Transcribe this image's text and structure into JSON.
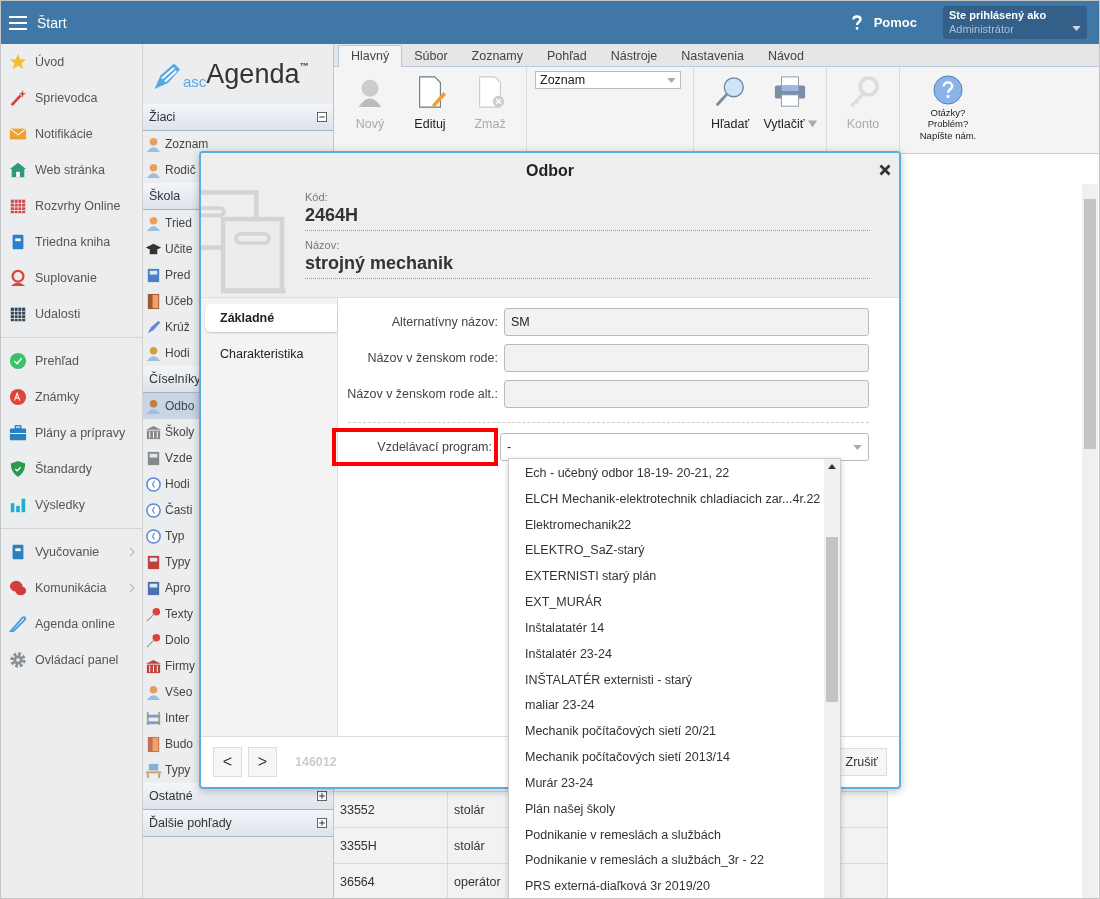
{
  "top_bar": {
    "title": "Štart",
    "help": "Pomoc",
    "user_caption": "Ste prihlásený ako",
    "user_name": "Administrátor"
  },
  "nav": {
    "groups": [
      [
        {
          "label": "Úvod",
          "submenu": false
        },
        {
          "label": "Sprievodca",
          "submenu": false
        },
        {
          "label": "Notifikácie",
          "submenu": false
        },
        {
          "label": "Web stránka",
          "submenu": false
        },
        {
          "label": "Rozvrhy Online",
          "submenu": false
        },
        {
          "label": "Triedna kniha",
          "submenu": false
        },
        {
          "label": "Suplovanie",
          "submenu": false
        },
        {
          "label": "Udalosti",
          "submenu": false
        }
      ],
      [
        {
          "label": "Prehľad",
          "submenu": false
        },
        {
          "label": "Známky",
          "submenu": false
        },
        {
          "label": "Plány a prípravy",
          "submenu": false
        },
        {
          "label": "Štandardy",
          "submenu": false
        },
        {
          "label": "Výsledky",
          "submenu": false
        }
      ],
      [
        {
          "label": "Vyučovanie",
          "submenu": true
        },
        {
          "label": "Komunikácia",
          "submenu": true
        },
        {
          "label": "Agenda online",
          "submenu": false
        },
        {
          "label": "Ovládací panel",
          "submenu": false
        }
      ]
    ]
  },
  "side_panel": {
    "logo": {
      "prefix": "asc",
      "name": "Agenda",
      "mark": "™"
    },
    "sections": [
      {
        "title": "Žiaci",
        "expanded": true,
        "items": [
          {
            "label": "Zoznam",
            "selected": false
          },
          {
            "label": "Rodič",
            "selected": false
          }
        ]
      },
      {
        "title": "Škola",
        "expanded": true,
        "items": [
          {
            "label": "Tried",
            "selected": false
          },
          {
            "label": "Učite",
            "selected": false
          },
          {
            "label": "Pred",
            "selected": false
          },
          {
            "label": "Učeb",
            "selected": false
          },
          {
            "label": "Krúž",
            "selected": false
          },
          {
            "label": "Hodi",
            "selected": false
          }
        ]
      },
      {
        "title": "Číselníky",
        "expanded": true,
        "items": [
          {
            "label": "Odbo",
            "selected": true
          },
          {
            "label": "Školy",
            "selected": false
          },
          {
            "label": "Vzde",
            "selected": false
          },
          {
            "label": "Hodi",
            "selected": false
          },
          {
            "label": "Časti",
            "selected": false
          },
          {
            "label": "Typ",
            "selected": false
          },
          {
            "label": "Typy",
            "selected": false
          },
          {
            "label": "Apro",
            "selected": false
          },
          {
            "label": "Texty",
            "selected": false
          },
          {
            "label": "Dolo",
            "selected": false
          },
          {
            "label": "Firmy",
            "selected": false
          },
          {
            "label": "Všeo",
            "selected": false
          },
          {
            "label": "Inter",
            "selected": false
          },
          {
            "label": "Budo",
            "selected": false
          },
          {
            "label": "Typy",
            "selected": false
          }
        ]
      },
      {
        "title": "Ostatné",
        "expanded": false
      },
      {
        "title": "Ďalšie pohľady",
        "expanded": false
      }
    ]
  },
  "ribbon": {
    "tabs": [
      {
        "label": "Hlavný",
        "selected": true
      },
      {
        "label": "Súbor",
        "selected": false
      },
      {
        "label": "Zoznamy",
        "selected": false
      },
      {
        "label": "Pohľad",
        "selected": false
      },
      {
        "label": "Nástroje",
        "selected": false
      },
      {
        "label": "Nastavenia",
        "selected": false
      },
      {
        "label": "Návod",
        "selected": false
      }
    ],
    "edit_buttons": [
      {
        "label": "Nový",
        "disabled": true
      },
      {
        "label": "Edituj",
        "disabled": false
      },
      {
        "label": "Zmaž",
        "disabled": true
      }
    ],
    "view_select": {
      "value": "Zoznam"
    },
    "action_buttons": [
      {
        "label": "Hľadať",
        "menu": false
      },
      {
        "label": "Vytlačiť",
        "menu": true
      }
    ],
    "account_button": {
      "label": "Konto",
      "disabled": true
    },
    "help_button": {
      "label": "Otázky?\nProblém?\nNapíšte nám."
    }
  },
  "table": {
    "rows": [
      [
        "33552",
        "stolár"
      ],
      [
        "3355H",
        "stolár"
      ],
      [
        "36564",
        "operátor"
      ]
    ]
  },
  "dialog": {
    "title": "Odbor",
    "code_label": "Kód:",
    "code": "2464H",
    "name_label": "Názov:",
    "name": "strojný mechanik",
    "tabs": [
      {
        "label": "Základné",
        "selected": true
      },
      {
        "label": "Charakteristika",
        "selected": false
      }
    ],
    "fields": [
      {
        "label": "Alternatívny názov:",
        "value": "SM"
      },
      {
        "label": "Názov v ženskom rode:"
      },
      {
        "label": "Názov v ženskom rode alt.:"
      }
    ],
    "program": {
      "label": "Vzdelávací program:",
      "value": "-",
      "highlighted": true,
      "expanded": true
    },
    "footer": {
      "prev": "<",
      "next": ">",
      "record": "146012",
      "cancel": "Zrušiť"
    }
  },
  "dropdown_options": [
    "Ech - učebný odbor 18-19- 20-21, 22",
    "ELCH Mechanik-elektrotechnik chladiacich zar...4r.22",
    "Elektromechanik22",
    "ELEKTRO_SaZ-starý",
    "EXTERNISTI starý plán",
    "EXT_MURÁR",
    "Inštalatatér 14",
    "Inštalatér 23-24",
    "INŠTALATÉR externisti - starý",
    "maliar 23-24",
    "Mechanik počítačových sietí 20/21",
    "Mechanik počítačových sietí 2013/14",
    "Murár 23-24",
    "Plán našej školy",
    "Podnikanie v remeslách a službách",
    "Podnikanie v remeslách a službách_3r - 22",
    "PRS externá-diaľková 3r 2019/20"
  ]
}
